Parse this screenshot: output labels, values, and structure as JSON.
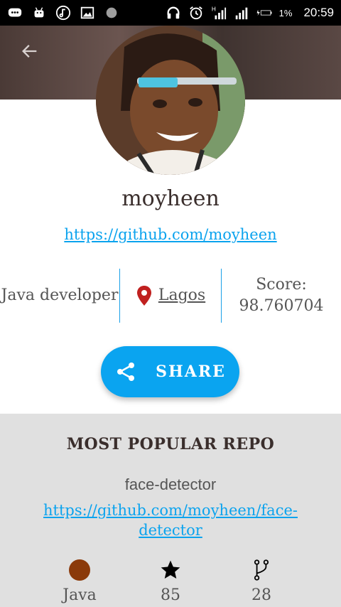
{
  "status_bar": {
    "battery_percent": "1%",
    "time": "20:59",
    "icons": [
      "message-icon",
      "android-icon",
      "music-icon",
      "image-icon",
      "dot-icon",
      "headphones-icon",
      "alarm-icon",
      "signal-h-icon",
      "signal-icon",
      "charging-icon",
      "battery-icon"
    ]
  },
  "header": {
    "back_icon": "arrow-left-icon"
  },
  "profile": {
    "username": "moyheen",
    "github_url": "https://github.com/moyheen",
    "role": "Java developer",
    "location": "Lagos",
    "score_label": "Score:",
    "score_value": "98.760704",
    "share_label": "SHARE",
    "pin_color": "#c0201f"
  },
  "repo": {
    "section_title": "MOST POPULAR REPO",
    "name": "face-detector",
    "url": "https://github.com/moyheen/face-detector",
    "language": "Java",
    "language_color": "#8b3a0a",
    "stars": "85",
    "forks": "28"
  },
  "colors": {
    "accent": "#0aa4f0",
    "repo_bg": "#e0e0e0"
  }
}
